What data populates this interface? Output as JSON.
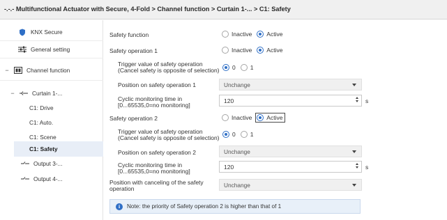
{
  "window": {
    "title": "-.-.- Multifunctional Actuator with Secure, 4-Fold > Channel function > Curtain 1-... > C1: Safety"
  },
  "sidebar": {
    "items": [
      {
        "label": "KNX Secure",
        "icon": "shield-icon"
      },
      {
        "label": "General setting",
        "icon": "sliders-icon"
      },
      {
        "label": "Channel function",
        "icon": "module-icon",
        "expander": "−"
      },
      {
        "label": "Curtain 1-...",
        "icon": "curtain-icon",
        "expander": "−"
      },
      {
        "label": "C1: Drive"
      },
      {
        "label": "C1: Auto."
      },
      {
        "label": "C1: Scene"
      },
      {
        "label": "C1: Safety",
        "selected": true
      },
      {
        "label": "Output 3-...",
        "icon": "output-icon"
      },
      {
        "label": "Output 4-...",
        "icon": "output-icon"
      }
    ]
  },
  "main": {
    "safety_function": {
      "label": "Safety function",
      "options": [
        "Inactive",
        "Active"
      ],
      "selected": "Active"
    },
    "safety_op1": {
      "label": "Safety operation 1",
      "options": [
        "Inactive",
        "Active"
      ],
      "selected": "Active"
    },
    "trigger1": {
      "label_line1": "Trigger value of safety operation",
      "label_line2": "(Cancel safety is opposite of  selection)",
      "options": [
        "0",
        "1"
      ],
      "selected": "0"
    },
    "position1": {
      "label": "Position on safety operation 1",
      "value": "Unchange"
    },
    "cyclic1": {
      "label_line1": "Cyclic monitoring time in",
      "label_line2": "[0...65535,0=no monitoring]",
      "value": "120",
      "unit": "s"
    },
    "safety_op2": {
      "label": "Safety operation 2",
      "options": [
        "Inactive",
        "Active"
      ],
      "selected": "Active"
    },
    "trigger2": {
      "label_line1": "Trigger value of safety operation",
      "label_line2": "(Cancel safety is opposite of  selection)",
      "options": [
        "0",
        "1"
      ],
      "selected": "0"
    },
    "position2": {
      "label": "Position on safety operation 2",
      "value": "Unchange"
    },
    "cyclic2": {
      "label_line1": "Cyclic monitoring time in",
      "label_line2": "[0...65535,0=no monitoring]",
      "value": "120",
      "unit": "s"
    },
    "cancel_position": {
      "label_line1": "Position with canceling of the safety",
      "label_line2": "operation",
      "value": "Unchange"
    },
    "note": "Note: the priority of Safety operation 2 is higher than that of 1"
  },
  "colors": {
    "accent": "#2f6fc6",
    "selected_bg": "#e8eef7",
    "note_bg": "#e8f0f9"
  }
}
